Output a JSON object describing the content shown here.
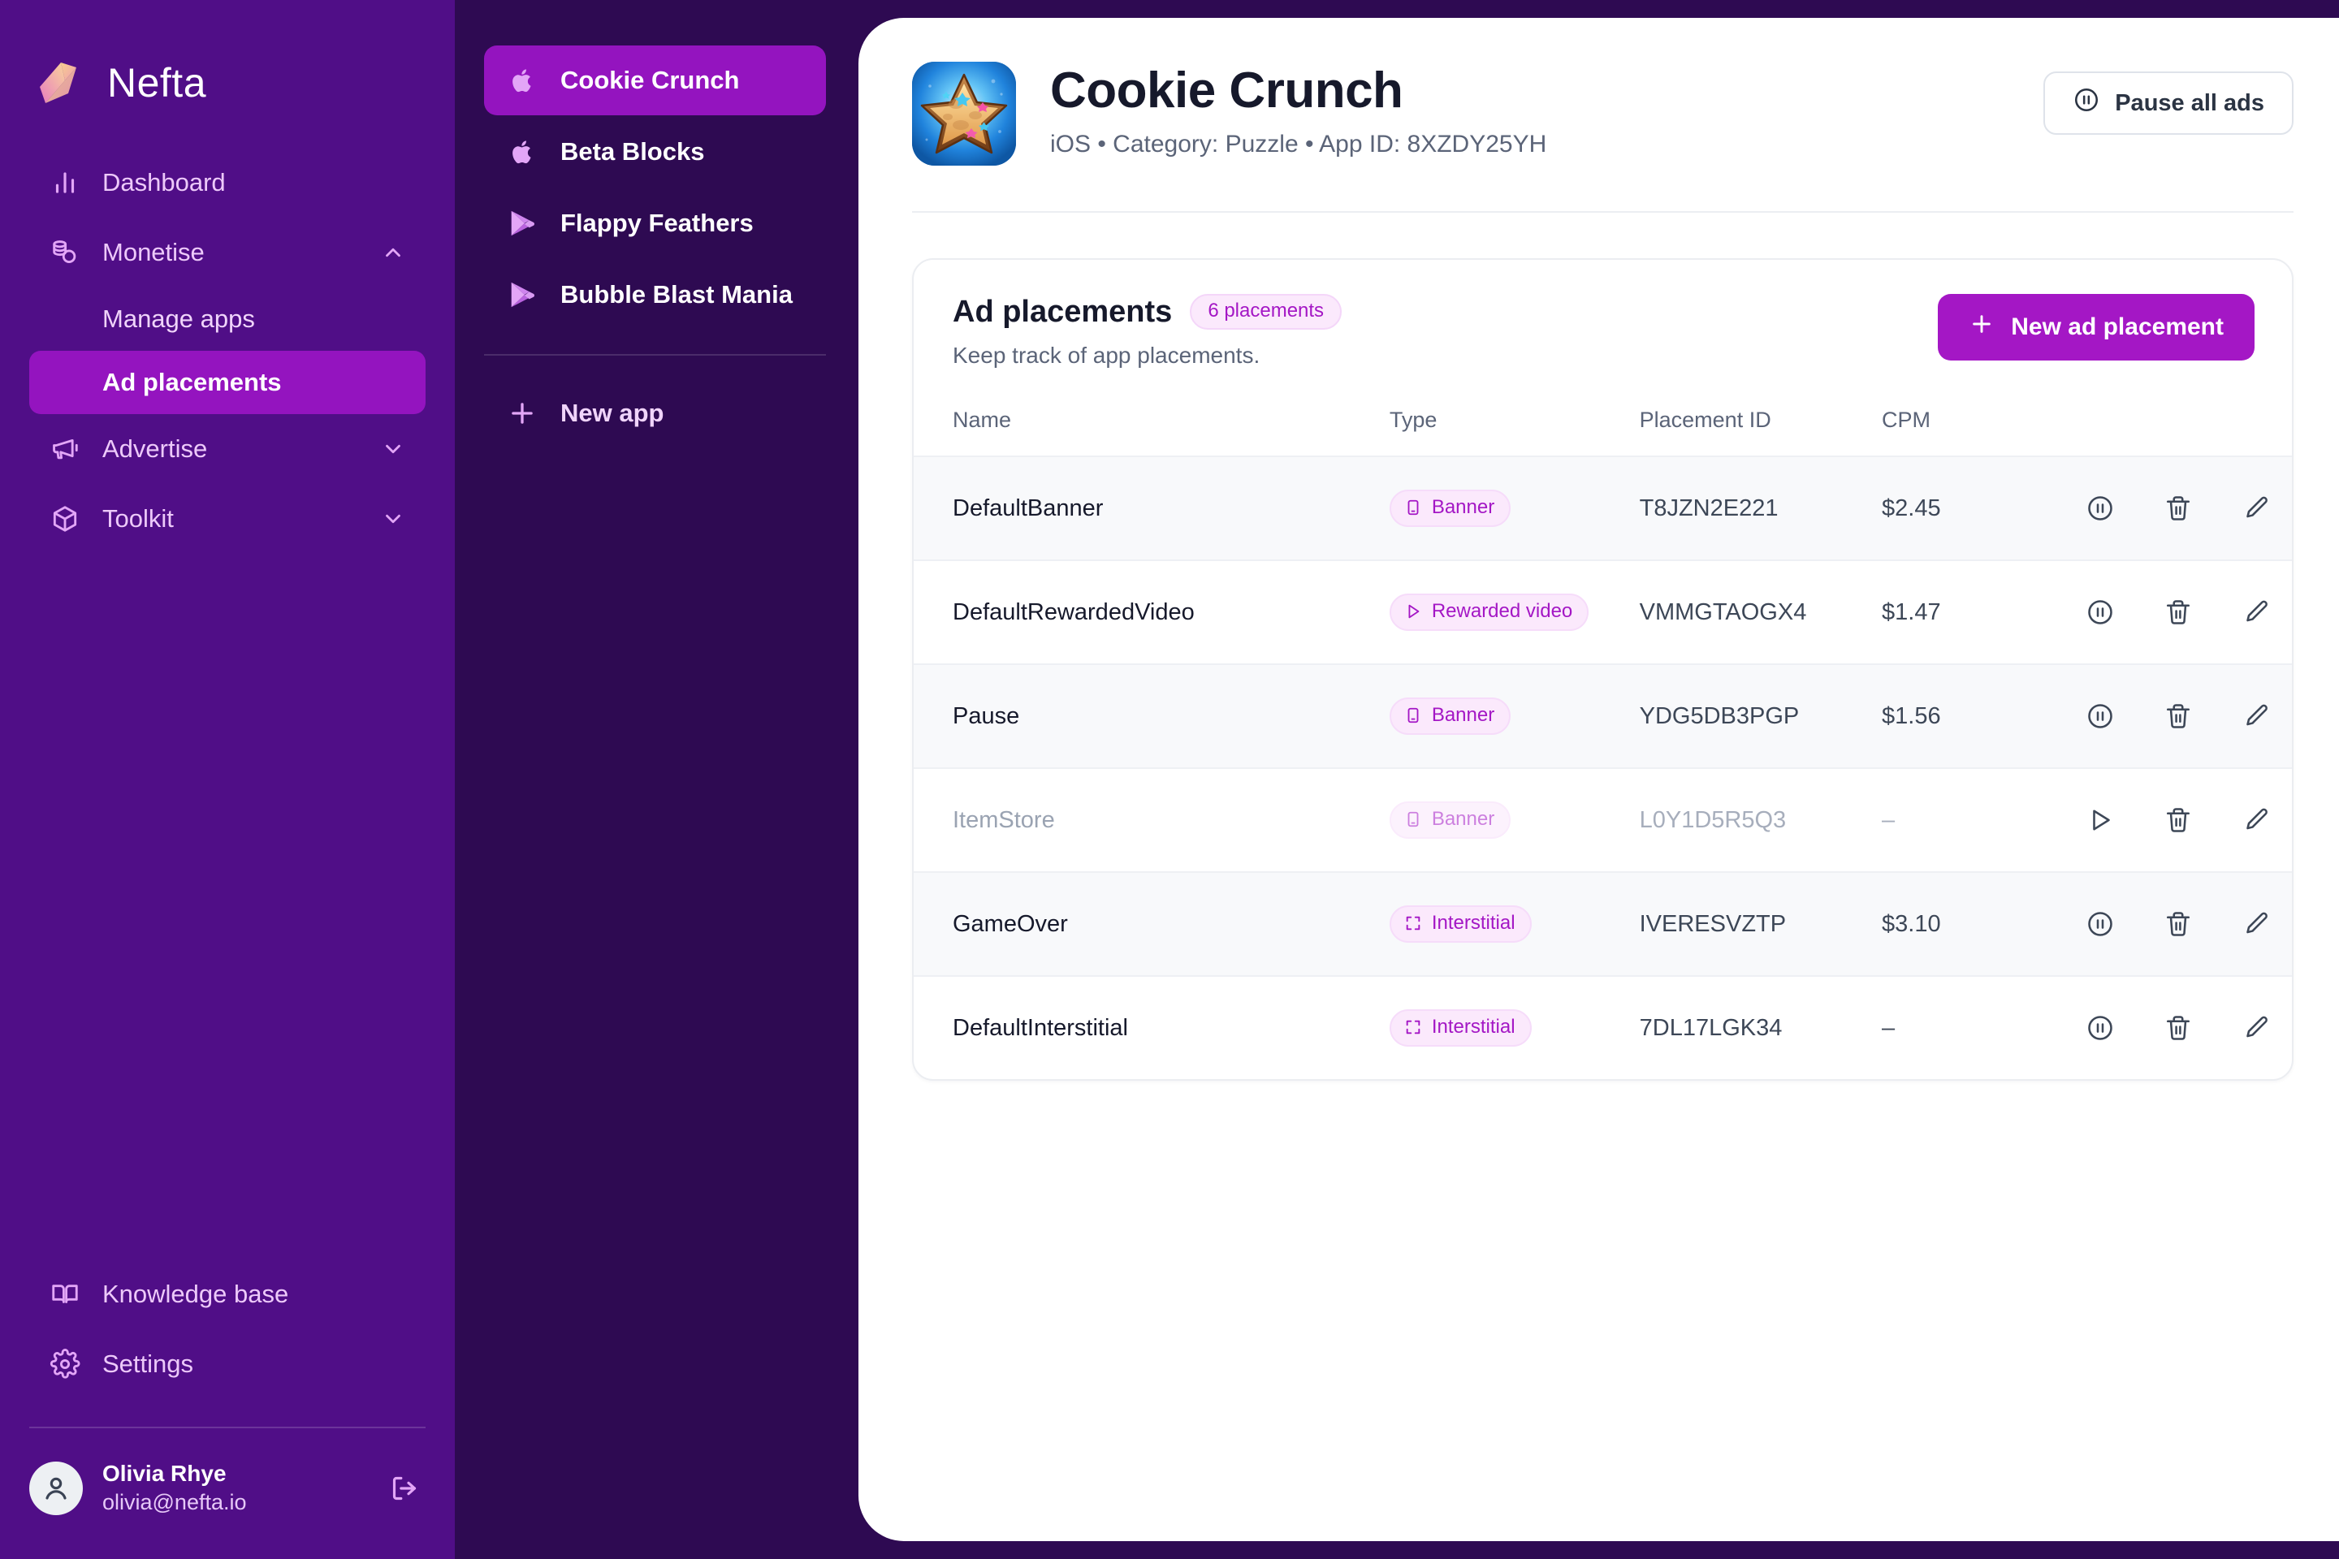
{
  "brand": {
    "name": "Nefta",
    "logo_icon": "nefta-cube-logo"
  },
  "sidebar": {
    "nav": [
      {
        "label": "Dashboard",
        "icon": "bar-chart-icon",
        "has_chevron": false,
        "active": false
      },
      {
        "label": "Monetise",
        "icon": "coins-icon",
        "has_chevron": true,
        "chevron": "chevron-up-icon",
        "active": false
      },
      {
        "label": "Advertise",
        "icon": "megaphone-icon",
        "has_chevron": true,
        "chevron": "chevron-down-icon",
        "active": false
      },
      {
        "label": "Toolkit",
        "icon": "cube-icon",
        "has_chevron": true,
        "chevron": "chevron-down-icon",
        "active": false
      }
    ],
    "sub_items": [
      {
        "label": "Manage apps",
        "active": false
      },
      {
        "label": "Ad placements",
        "active": true
      }
    ],
    "bottom": [
      {
        "label": "Knowledge base",
        "icon": "book-open-icon"
      },
      {
        "label": "Settings",
        "icon": "gear-icon"
      }
    ],
    "user": {
      "name": "Olivia Rhye",
      "email": "olivia@nefta.io",
      "avatar_icon": "user-avatar-icon",
      "logout_icon": "logout-icon"
    }
  },
  "applist": {
    "apps": [
      {
        "label": "Cookie Crunch",
        "platform_icon": "apple-icon",
        "active": true
      },
      {
        "label": "Beta Blocks",
        "platform_icon": "apple-icon",
        "active": false
      },
      {
        "label": "Flappy Feathers",
        "platform_icon": "google-play-icon",
        "active": false
      },
      {
        "label": "Bubble Blast Mania",
        "platform_icon": "google-play-icon",
        "active": false
      }
    ],
    "new_app": {
      "label": "New app",
      "icon": "plus-icon"
    }
  },
  "header": {
    "app_icon": "cookie-star-app-icon",
    "title": "Cookie Crunch",
    "subtitle": "iOS • Category: Puzzle • App ID: 8XZDY25YH",
    "pause_all": {
      "label": "Pause all ads",
      "icon": "pause-circle-icon"
    }
  },
  "card": {
    "title": "Ad placements",
    "badge": "6 placements",
    "subtitle": "Keep track of app placements.",
    "new_button": {
      "label": "New ad placement",
      "icon": "plus-icon"
    },
    "columns": [
      "Name",
      "Type",
      "Placement ID",
      "CPM",
      ""
    ],
    "rows": [
      {
        "name": "DefaultBanner",
        "type": "Banner",
        "type_icon": "banner-icon",
        "placement_id": "T8JZN2E221",
        "cpm": "$2.45",
        "enabled": true,
        "toggle_icon": "pause-circle-icon",
        "delete_icon": "trash-icon",
        "edit_icon": "pencil-icon"
      },
      {
        "name": "DefaultRewardedVideo",
        "type": "Rewarded video",
        "type_icon": "play-icon",
        "placement_id": "VMMGTAOGX4",
        "cpm": "$1.47",
        "enabled": true,
        "toggle_icon": "pause-circle-icon",
        "delete_icon": "trash-icon",
        "edit_icon": "pencil-icon"
      },
      {
        "name": "Pause",
        "type": "Banner",
        "type_icon": "banner-icon",
        "placement_id": "YDG5DB3PGP",
        "cpm": "$1.56",
        "enabled": true,
        "toggle_icon": "pause-circle-icon",
        "delete_icon": "trash-icon",
        "edit_icon": "pencil-icon"
      },
      {
        "name": "ItemStore",
        "type": "Banner",
        "type_icon": "banner-icon",
        "placement_id": "L0Y1D5R5Q3",
        "cpm": "–",
        "enabled": false,
        "toggle_icon": "play-icon",
        "delete_icon": "trash-icon",
        "edit_icon": "pencil-icon"
      },
      {
        "name": "GameOver",
        "type": "Interstitial",
        "type_icon": "interstitial-icon",
        "placement_id": "IVERESVZTP",
        "cpm": "$3.10",
        "enabled": true,
        "toggle_icon": "pause-circle-icon",
        "delete_icon": "trash-icon",
        "edit_icon": "pencil-icon"
      },
      {
        "name": "DefaultInterstitial",
        "type": "Interstitial",
        "type_icon": "interstitial-icon",
        "placement_id": "7DL17LGK34",
        "cpm": "–",
        "enabled": true,
        "toggle_icon": "pause-circle-icon",
        "delete_icon": "trash-icon",
        "edit_icon": "pencil-icon"
      }
    ]
  },
  "colors": {
    "sidebar_bg": "#500E87",
    "applist_bg": "#2E0A52",
    "accent": "#9414BF",
    "accent_btn": "#A417C5",
    "pill_bg": "#FBE9FC",
    "main_bg": "#FFFFFF",
    "row_alt_bg": "#F8F9FB"
  }
}
